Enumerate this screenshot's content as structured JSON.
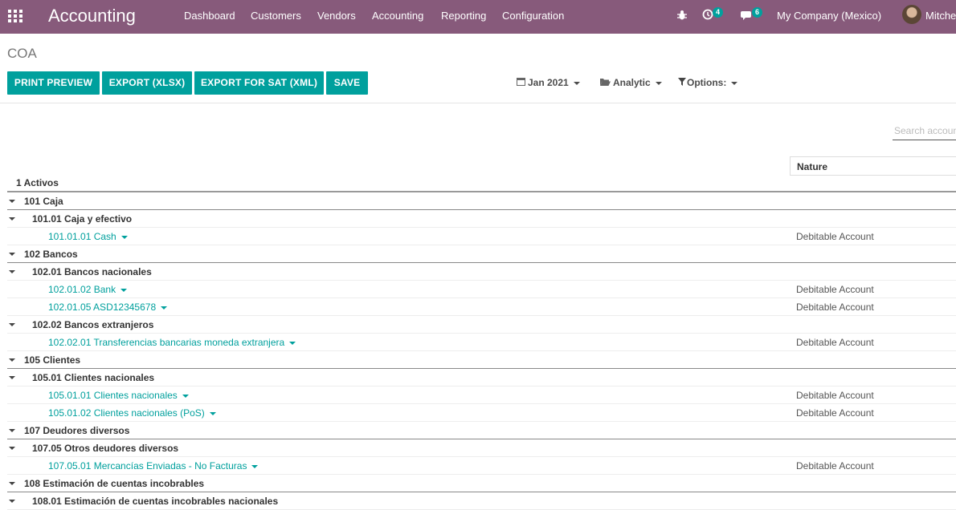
{
  "navbar": {
    "app_title": "Accounting",
    "menu": [
      "Dashboard",
      "Customers",
      "Vendors",
      "Accounting",
      "Reporting",
      "Configuration"
    ],
    "activity_badge": "4",
    "messages_badge": "6",
    "company": "My Company (Mexico)",
    "user": "Mitchell Admin",
    "color": "#875a7b"
  },
  "breadcrumb": "COA",
  "buttons": {
    "print_preview": "PRINT PREVIEW",
    "export_xlsx": "EXPORT (XLSX)",
    "export_sat": "EXPORT FOR SAT (XML)",
    "save": "SAVE",
    "color": "#00a09d"
  },
  "filters": {
    "date": "Jan 2021",
    "analytic": "Analytic",
    "options": "Options:"
  },
  "search": {
    "placeholder": "Search account"
  },
  "table": {
    "nature_header": "Nature",
    "rows": [
      {
        "level": "l0",
        "label": "1 Activos",
        "nature": ""
      },
      {
        "level": "l1",
        "label": "101 Caja",
        "nature": ""
      },
      {
        "level": "l2",
        "label": "101.01 Caja y efectivo",
        "nature": ""
      },
      {
        "level": "leaf",
        "label": "101.01.01 Cash",
        "nature": "Debitable Account"
      },
      {
        "level": "l1",
        "label": "102 Bancos",
        "nature": ""
      },
      {
        "level": "l2",
        "label": "102.01 Bancos nacionales",
        "nature": ""
      },
      {
        "level": "leaf",
        "label": "102.01.02 Bank",
        "nature": "Debitable Account"
      },
      {
        "level": "leaf",
        "label": "102.01.05 ASD12345678",
        "nature": "Debitable Account"
      },
      {
        "level": "l2",
        "label": "102.02 Bancos extranjeros",
        "nature": ""
      },
      {
        "level": "leaf",
        "label": "102.02.01 Transferencias bancarias moneda extranjera",
        "nature": "Debitable Account"
      },
      {
        "level": "l1",
        "label": "105 Clientes",
        "nature": ""
      },
      {
        "level": "l2",
        "label": "105.01 Clientes nacionales",
        "nature": ""
      },
      {
        "level": "leaf",
        "label": "105.01.01 Clientes nacionales",
        "nature": "Debitable Account"
      },
      {
        "level": "leaf",
        "label": "105.01.02 Clientes nacionales (PoS)",
        "nature": "Debitable Account"
      },
      {
        "level": "l1",
        "label": "107 Deudores diversos",
        "nature": ""
      },
      {
        "level": "l2",
        "label": "107.05 Otros deudores diversos",
        "nature": ""
      },
      {
        "level": "leaf",
        "label": "107.05.01 Mercancías Enviadas - No Facturas",
        "nature": "Debitable Account"
      },
      {
        "level": "l1",
        "label": "108 Estimación de cuentas incobrables",
        "nature": ""
      },
      {
        "level": "l2",
        "label": "108.01 Estimación de cuentas incobrables nacionales",
        "nature": ""
      }
    ]
  }
}
